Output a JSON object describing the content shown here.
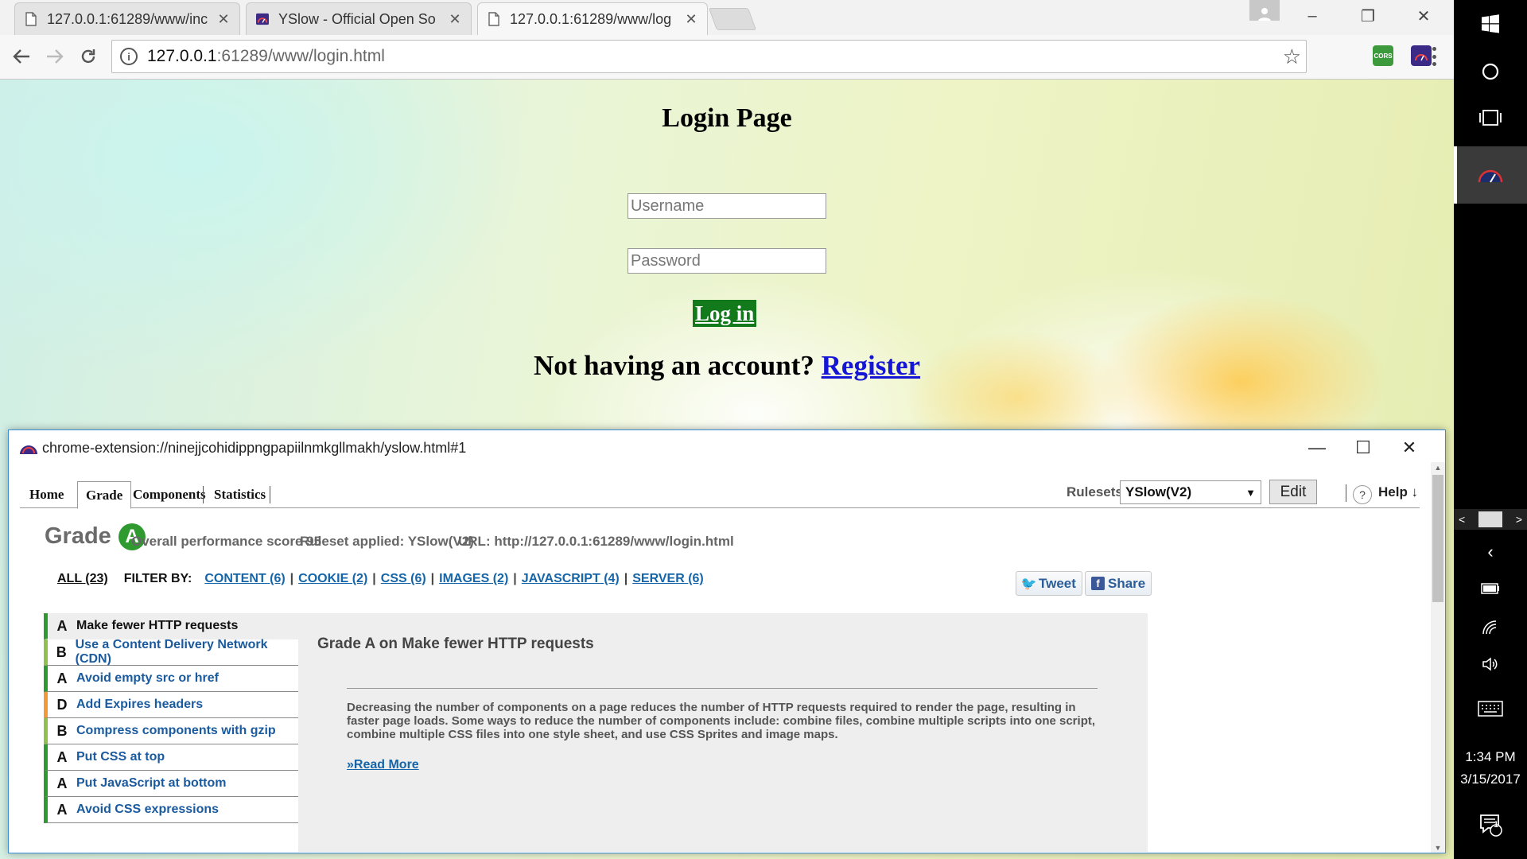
{
  "browser": {
    "tabs": [
      {
        "title": "127.0.0.1:61289/www/inc",
        "active": false
      },
      {
        "title": "YSlow - Official Open So",
        "active": false
      },
      {
        "title": "127.0.0.1:61289/www/log",
        "active": true
      }
    ],
    "url_host": "127.0.0.1",
    "url_rest": ":61289/www/login.html",
    "extensions": [
      "cors-extension-icon",
      "yslow-extension-icon"
    ],
    "cors_label": "CORS"
  },
  "page": {
    "title": "Login Page",
    "username_placeholder": "Username",
    "password_placeholder": "Password",
    "login_button": "Log in",
    "register_prompt": "Not having an account?",
    "register_link": "Register"
  },
  "yslow": {
    "window_title": "chrome-extension://ninejjcohidippngpapiilnmkgllmakh/yslow.html#1",
    "tabs": [
      "Home",
      "Grade",
      "Components",
      "Statistics"
    ],
    "selected_tab": "Grade",
    "rulesets_label": "Rulesets",
    "ruleset_value": "YSlow(V2)",
    "edit_label": "Edit",
    "help_label": "Help ↓",
    "grade_word": "Grade",
    "grade_letter": "A",
    "score_text": "Overall performance score 95",
    "ruleset_applied": "Ruleset applied: YSlow(V2)",
    "url_text": "URL: http://127.0.0.1:61289/www/login.html",
    "filter": {
      "all": "ALL (23)",
      "filter_by": "FILTER BY:",
      "links": [
        "CONTENT (6)",
        "COOKIE (2)",
        "CSS (6)",
        "IMAGES (2)",
        "JAVASCRIPT (4)",
        "SERVER (6)"
      ]
    },
    "tweet_label": "Tweet",
    "share_label": "Share",
    "rules": [
      {
        "grade": "A",
        "name": "Make fewer HTTP requests",
        "selected": true
      },
      {
        "grade": "B",
        "name": "Use a Content Delivery Network (CDN)",
        "selected": false
      },
      {
        "grade": "A",
        "name": "Avoid empty src or href",
        "selected": false
      },
      {
        "grade": "D",
        "name": "Add Expires headers",
        "selected": false
      },
      {
        "grade": "B",
        "name": "Compress components with gzip",
        "selected": false
      },
      {
        "grade": "A",
        "name": "Put CSS at top",
        "selected": false
      },
      {
        "grade": "A",
        "name": "Put JavaScript at bottom",
        "selected": false
      },
      {
        "grade": "A",
        "name": "Avoid CSS expressions",
        "selected": false
      }
    ],
    "detail": {
      "heading": "Grade A on Make fewer HTTP requests",
      "body": "Decreasing the number of components on a page reduces the number of HTTP requests required to render the page, resulting in faster page loads. Some ways to reduce the number of components include: combine files, combine multiple scripts into one script, combine multiple CSS files into one style sheet, and use CSS Sprites and image maps.",
      "read_more": "»Read More"
    },
    "grade_colors": {
      "A": "#2f9a2f",
      "B": "#8fc24a",
      "D": "#f39a36"
    }
  },
  "taskbar": {
    "time": "1:34 PM",
    "date": "3/15/2017",
    "notification_count": "1"
  }
}
